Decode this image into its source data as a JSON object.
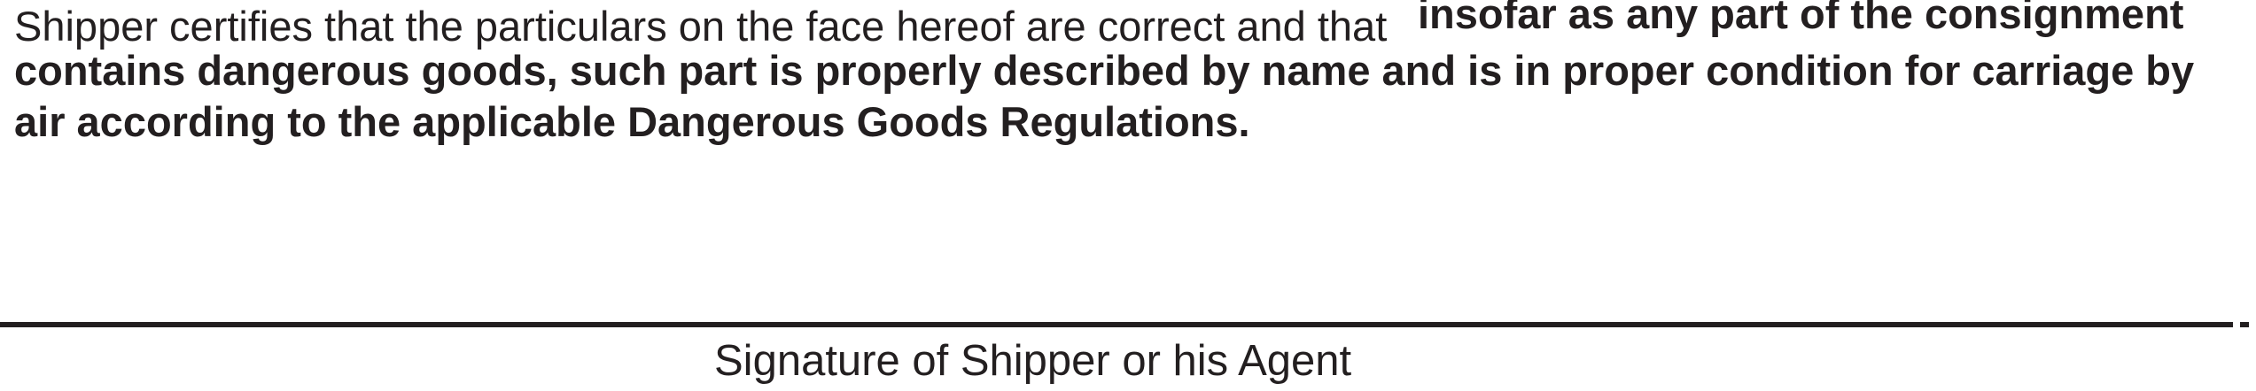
{
  "certification": {
    "line1_normal": "Shipper certifies that the particulars on the face hereof are correct and that",
    "line1_bold": "insofar as any part of the consignment",
    "line2": "contains dangerous goods, such part is properly described by name and is in proper condition for carriage by",
    "line3": "air according to the applicable Dangerous Goods Regulations."
  },
  "signature": {
    "label": "Signature of Shipper or his Agent"
  }
}
